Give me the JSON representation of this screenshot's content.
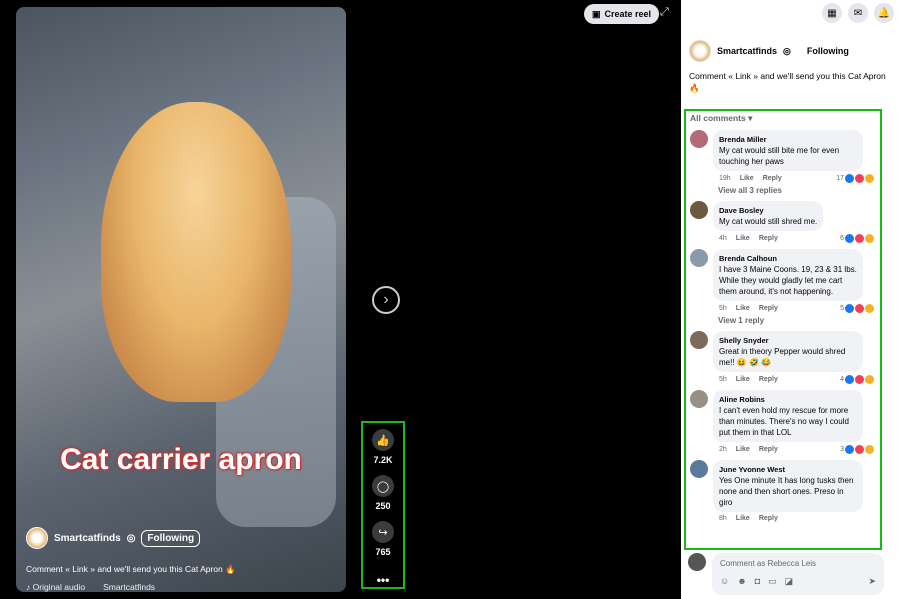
{
  "video": {
    "overlay_title": "Cat carrier apron",
    "author": "Smartcatfinds",
    "follow_label": "Following",
    "caption": "Comment « Link » and we'll send you this Cat Apron 🔥",
    "audio_label": "Original audio",
    "audio_author": "Smartcatfinds"
  },
  "actions": {
    "like_count": "7.2K",
    "comment_count": "250",
    "share_count": "765",
    "more_label": "•••"
  },
  "top": {
    "create_reel_label": "Create reel"
  },
  "post": {
    "author": "Smartcatfinds",
    "following_label": "Following",
    "text": "Comment « Link » and we'll send you this Cat Apron 🔥"
  },
  "comments": {
    "sort_label": "All comments ▾",
    "items": [
      {
        "name": "Brenda Miller",
        "text": "My cat would still bite me for even touching her paws",
        "time": "19h",
        "like": "Like",
        "reply": "Reply",
        "reactions": "17",
        "replies_label": "View all 3 replies",
        "avatar_color": "#b56a7a"
      },
      {
        "name": "Dave Bosley",
        "text": "My cat would still shred me.",
        "time": "4h",
        "like": "Like",
        "reply": "Reply",
        "reactions": "6",
        "replies_label": "",
        "avatar_color": "#6b5a3e"
      },
      {
        "name": "Brenda Calhoun",
        "text": "I have 3 Maine Coons. 19, 23 & 31 lbs. While they would gladly let me cart them around, it's not happening.",
        "time": "5h",
        "like": "Like",
        "reply": "Reply",
        "reactions": "5",
        "replies_label": "View 1 reply",
        "avatar_color": "#8a9aa8"
      },
      {
        "name": "Shelly Snyder",
        "text": "Great in theory Pepper would shred me!! 😆 🤣 😂",
        "time": "5h",
        "like": "Like",
        "reply": "Reply",
        "reactions": "4",
        "replies_label": "",
        "avatar_color": "#7d6a5a"
      },
      {
        "name": "Aline Robins",
        "text": "I can't even hold my rescue for more than minutes. There's no way I could put them in that LOL",
        "time": "2h",
        "like": "Like",
        "reply": "Reply",
        "reactions": "3",
        "replies_label": "",
        "avatar_color": "#9a8f86"
      },
      {
        "name": "June Yvonne West",
        "text": "Yes One minute It has long tusks then none and then short ones. Preso in giro",
        "time": "8h",
        "like": "Like",
        "reply": "Reply",
        "reactions": "",
        "replies_label": "",
        "avatar_color": "#5a7aa0"
      }
    ]
  },
  "composer": {
    "placeholder": "Comment as Rebecca Leis"
  },
  "colors": {
    "highlight": "#19b91b",
    "like_blue": "#1877f2",
    "love_red": "#f33e58",
    "haha_yellow": "#f7b125"
  }
}
